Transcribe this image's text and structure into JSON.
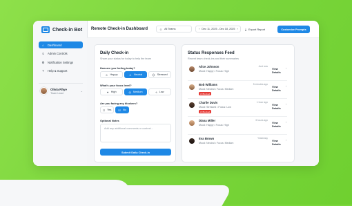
{
  "app": {
    "name": "Check-in Bot",
    "accent": "#1e88e5",
    "brand_icon": "chat-bubble-icon"
  },
  "sidebar": {
    "items": [
      {
        "label": "Dashboard",
        "icon": "home-icon",
        "active": true
      },
      {
        "label": "Admin Controls",
        "icon": "people-icon",
        "active": false
      },
      {
        "label": "Notification Settings",
        "icon": "gear-icon",
        "active": false
      },
      {
        "label": "Help & Support",
        "icon": "help-icon",
        "active": false
      }
    ],
    "user": {
      "name": "Olivia Rhye",
      "role": "Team Lead"
    }
  },
  "header": {
    "title": "Remote Check-in Dashboard",
    "team_select": "All Teams",
    "date_range": "Dec 11, 2025 - Dec 18, 2025",
    "export_label": "Export Report",
    "customize_label": "Customize Prompts"
  },
  "checkin": {
    "title": "Daily Check-in",
    "subtitle": "Share your status for today to help the team",
    "q1": "How are you feeling today?",
    "q1_options": [
      "Happy",
      "Neutral",
      "Stressed"
    ],
    "q1_selected": "Neutral",
    "q2": "What's your focus level?",
    "q2_options": [
      "High",
      "Medium",
      "Low"
    ],
    "q2_selected": "Medium",
    "q3": "Are you facing any blockers?",
    "q3_options": [
      "Yes",
      "No"
    ],
    "q3_selected": "No",
    "notes_label": "Optional Notes",
    "notes_placeholder": "Add any additional comments or context...",
    "submit_label": "Submit Daily Check-in"
  },
  "feed": {
    "title": "Status Responses Feed",
    "subtitle": "Recent team check-ins and their summaries",
    "view_label": "View Details",
    "blocked_label": "Blocked",
    "rows": [
      {
        "name": "Alice Johnson",
        "meta": "Mood: Happy • Focus: High",
        "time": "Just now",
        "blocked": false
      },
      {
        "name": "Bob Williams",
        "meta": "Mood: Neutral • Focus: Medium",
        "time": "5 minutes ago",
        "blocked": true
      },
      {
        "name": "Charlie Davis",
        "meta": "Mood: Stressed • Focus: Low",
        "time": "1 hour ago",
        "blocked": true
      },
      {
        "name": "Diana Miller",
        "meta": "Mood: Happy • Focus: High",
        "time": "3 hours ago",
        "blocked": false
      },
      {
        "name": "Eva Brown",
        "meta": "Mood: Neutral • Focus: Medium",
        "time": "Yesterday",
        "blocked": false
      }
    ]
  }
}
